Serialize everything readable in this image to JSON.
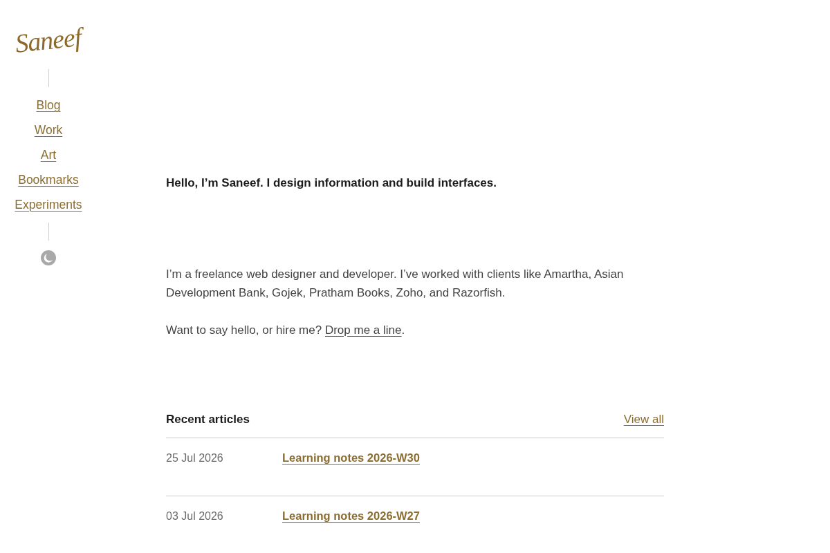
{
  "logo": "Saneef",
  "nav": [
    {
      "label": "Blog"
    },
    {
      "label": "Work"
    },
    {
      "label": "Art"
    },
    {
      "label": "Bookmarks"
    },
    {
      "label": "Experiments"
    }
  ],
  "intro": {
    "heading": "Hello, I’m Saneef. I design information and build interfaces.",
    "paragraph": "I’m a freelance web designer and developer. I’ve worked with clients like Amartha, Asian Development Bank, Gojek, Pratham Books, Zoho, and Razorfish.",
    "contact": {
      "text": "Want to say hello, or hire me?",
      "link": "Drop me a line",
      "end": "."
    }
  },
  "recent_articles": {
    "title": "Recent articles",
    "view_all": "View all",
    "items": [
      {
        "date": "25 Jul 2026",
        "title": "Learning notes 2026-W30"
      },
      {
        "date": "03 Jul 2026",
        "title": "Learning notes 2026-W27"
      }
    ]
  }
}
